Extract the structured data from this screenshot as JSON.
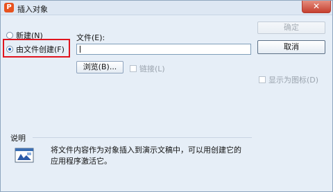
{
  "window": {
    "title": "插入对象",
    "app_icon_glyph": "P",
    "close_glyph": "✕"
  },
  "options": {
    "create_new": "新建(N)",
    "create_from_file": "由文件创建(F)",
    "selected": "create_from_file"
  },
  "file": {
    "label": "文件(E):",
    "value": ""
  },
  "buttons": {
    "browse": "浏览(B)...",
    "ok": "确定",
    "cancel": "取消"
  },
  "checkboxes": {
    "link": "链接(L)",
    "display_as_icon": "显示为图标(D)"
  },
  "description": {
    "title": "说明",
    "text_line1": "将文件内容作为对象插入到演示文稿中，可以用创建它的",
    "text_line2": "应用程序激活它。"
  },
  "colors": {
    "highlight": "#e0141e",
    "radio_dot": "#1d5fb0",
    "app_icon": "#e8531f"
  }
}
